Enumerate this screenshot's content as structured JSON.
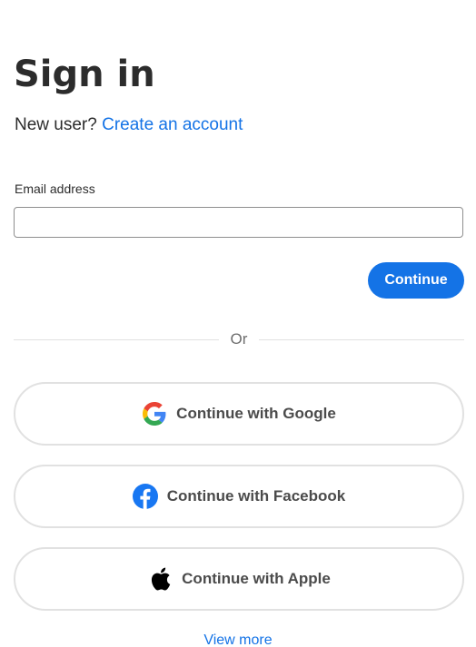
{
  "header": {
    "title": "Sign in",
    "new_user_prompt": "New user?",
    "create_account_link": "Create an account"
  },
  "form": {
    "email_label": "Email address",
    "email_value": "",
    "continue_label": "Continue"
  },
  "divider": {
    "label": "Or"
  },
  "social": {
    "google_label": "Continue with Google",
    "facebook_label": "Continue with Facebook",
    "apple_label": "Continue with Apple",
    "google_icon": "google-icon",
    "facebook_icon": "facebook-icon",
    "apple_icon": "apple-icon"
  },
  "footer": {
    "view_more_link": "View more"
  },
  "colors": {
    "accent": "#1473e6",
    "text": "#2c2c2c",
    "border": "#e1e1e1",
    "facebook": "#1877f2"
  }
}
